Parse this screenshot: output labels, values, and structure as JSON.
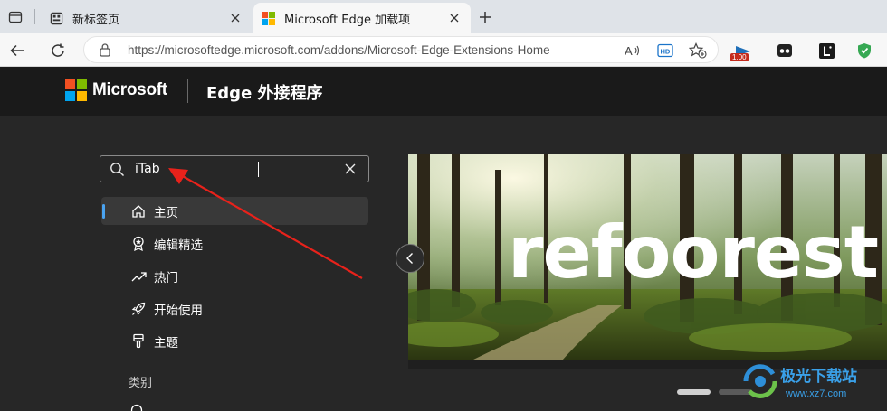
{
  "tabs": [
    {
      "label": "新标签页",
      "icon": "new-tab-page-icon",
      "active": false
    },
    {
      "label": "Microsoft Edge 加载项",
      "icon": "microsoft-logo-icon",
      "active": true
    }
  ],
  "address_bar": {
    "url": "https://microsoftedge.microsoft.com/addons/Microsoft-Edge-Extensions-Home"
  },
  "extensions": {
    "badge_text": "1.00"
  },
  "site": {
    "brand": "Microsoft",
    "title": "Edge 外接程序",
    "logo_colors": [
      "#f25022",
      "#7fba00",
      "#00a4ef",
      "#ffb900"
    ]
  },
  "search": {
    "value": "iTab"
  },
  "sidebar": {
    "items": [
      {
        "label": "主页",
        "icon": "home-icon",
        "selected": true
      },
      {
        "label": "编辑精选",
        "icon": "award-badge-icon",
        "selected": false
      },
      {
        "label": "热门",
        "icon": "trending-icon",
        "selected": false
      },
      {
        "label": "开始使用",
        "icon": "rocket-icon",
        "selected": false
      },
      {
        "label": "主题",
        "icon": "paintbrush-icon",
        "selected": false
      }
    ],
    "section_label": "类别"
  },
  "banner": {
    "headline": "refoorest"
  },
  "watermark": {
    "name": "极光下载站",
    "url": "www.xz7.com"
  },
  "colors": {
    "accent": "#4aa3f0",
    "annotation_arrow": "#e8221b",
    "watermark": "#3aa0e8"
  }
}
